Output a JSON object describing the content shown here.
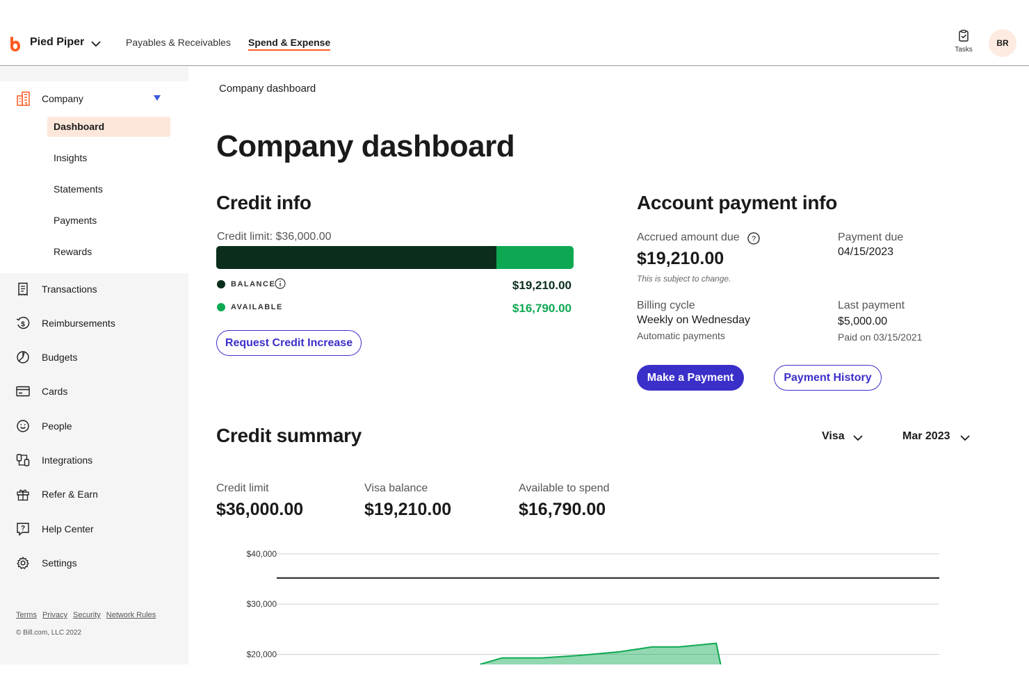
{
  "topbar": {
    "brand": "Pied Piper",
    "nav": [
      "Payables & Receivables",
      "Spend & Expense"
    ],
    "active_nav": "Spend & Expense",
    "tasks_label": "Tasks",
    "avatar_initials": "BR",
    "brand_color": "#ff5a1f"
  },
  "sidebar": {
    "section": "Company",
    "subitems": [
      "Dashboard",
      "Insights",
      "Statements",
      "Payments",
      "Rewards"
    ],
    "active_subitem": "Dashboard",
    "items": [
      {
        "label": "Transactions",
        "icon": "receipt-icon"
      },
      {
        "label": "Reimbursements",
        "icon": "reimbursement-icon"
      },
      {
        "label": "Budgets",
        "icon": "pie-chart-icon"
      },
      {
        "label": "Cards",
        "icon": "credit-card-icon"
      },
      {
        "label": "People",
        "icon": "smiley-icon"
      },
      {
        "label": "Integrations",
        "icon": "integrations-icon"
      },
      {
        "label": "Refer & Earn",
        "icon": "gift-icon"
      },
      {
        "label": "Help Center",
        "icon": "help-icon"
      },
      {
        "label": "Settings",
        "icon": "gear-icon"
      }
    ],
    "footer_links": [
      "Terms",
      "Privacy",
      "Security",
      "Network Rules"
    ],
    "copyright": "© Bill.com, LLC 2022"
  },
  "main": {
    "breadcrumb": "Company dashboard",
    "title": "Company dashboard",
    "credit_info": {
      "heading": "Credit info",
      "limit_label": "Credit limit: $36,000.00",
      "balance_fraction": 0.7837,
      "balance_label": "BALANCE",
      "balance_value": "$19,210.00",
      "available_label": "AVAILABLE",
      "available_value": "$16,790.00",
      "balance_color": "#0b2e1c",
      "available_color": "#0ea853",
      "button": "Request Credit Increase"
    },
    "account_payment": {
      "heading": "Account payment info",
      "accrued_label": "Accrued amount due",
      "accrued_value": "$19,210.00",
      "accrued_note": "This is subject to change.",
      "due_label": "Payment due",
      "due_value": "04/15/2023",
      "billing_label": "Billing cycle",
      "billing_value": "Weekly on Wednesday",
      "billing_sub": "Automatic payments",
      "last_label": "Last payment",
      "last_value": "$5,000.00",
      "last_sub": "Paid on 03/15/2021",
      "make_payment": "Make a Payment",
      "payment_history": "Payment History",
      "accent_color": "#3b2fc9"
    },
    "credit_summary": {
      "heading": "Credit summary",
      "card_select": "Visa",
      "month_select": "Mar 2023",
      "stats": [
        {
          "label": "Credit limit",
          "value": "$36,000.00"
        },
        {
          "label": "Visa balance",
          "value": "$19,210.00"
        },
        {
          "label": "Available to spend",
          "value": "$16,790.00"
        }
      ]
    }
  },
  "chart_data": {
    "type": "area",
    "y_ticks": [
      "$40,000",
      "$30,000",
      "$20,000"
    ],
    "ylim": [
      18000,
      41500
    ],
    "xlim": [
      0,
      30
    ],
    "limit_line": 35200,
    "series": [
      {
        "x": [
          9.2,
          10.2,
          12,
          13.7,
          15.5,
          17,
          18.2,
          19.9,
          20.1
        ],
        "values": [
          18000,
          19300,
          19300,
          19800,
          20500,
          21500,
          21500,
          22200,
          18000
        ]
      }
    ],
    "area_color": "#0ea853",
    "grid": true
  }
}
